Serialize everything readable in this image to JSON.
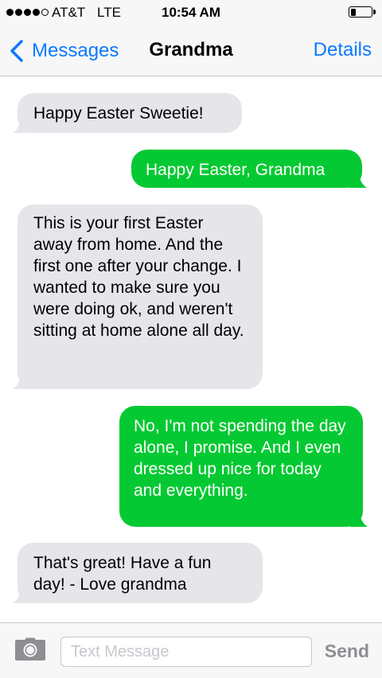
{
  "status_bar": {
    "carrier": "AT&T",
    "network": "LTE",
    "time": "10:54 AM",
    "signal_bars_filled": 4,
    "signal_bars_total": 5,
    "battery_level": 0.25
  },
  "nav": {
    "back_label": "Messages",
    "title": "Grandma",
    "details_label": "Details",
    "accent_color": "#0a7aff"
  },
  "messages": [
    {
      "direction": "incoming",
      "text": "Happy Easter Sweetie!"
    },
    {
      "direction": "outgoing",
      "text": "Happy Easter, Grandma"
    },
    {
      "direction": "incoming",
      "text": "This is your first Easter away from home. And the first one after your change. I wanted to make sure you were doing ok, and weren't sitting at home alone all day."
    },
    {
      "direction": "outgoing",
      "text": "No, I'm not spending the day alone, I promise. And I even dressed up nice for today and everything."
    },
    {
      "direction": "incoming",
      "text": "That's great! Have a fun day! - Love grandma"
    }
  ],
  "colors": {
    "incoming_bubble": "#e5e5ea",
    "outgoing_bubble": "#05c932"
  },
  "input_bar": {
    "camera_icon": "camera-icon",
    "placeholder": "Text Message",
    "value": "",
    "send_label": "Send"
  }
}
